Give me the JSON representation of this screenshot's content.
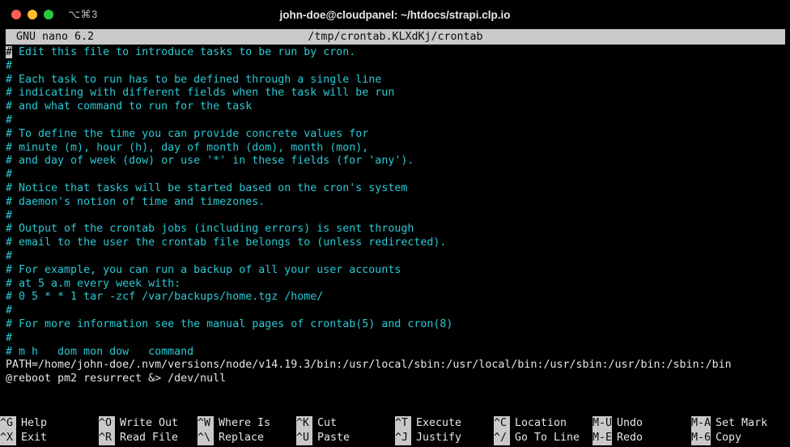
{
  "window": {
    "title": "john-doe@cloudpanel: ~/htdocs/strapi.clp.io",
    "shortcut_badge": "⌥⌘3",
    "traffic_lights": {
      "close": "close-button",
      "minimize": "minimize-button",
      "maximize": "maximize-button"
    },
    "colors": {
      "close": "#ff5f57",
      "minimize": "#febc2e",
      "maximize": "#28c840",
      "background": "#000000",
      "comment_text": "#2ac9d4",
      "plain_text": "#e6e6e6",
      "inverse_bg": "#c9c9c9"
    }
  },
  "nano": {
    "version": "GNU nano 6.2",
    "filename": "/tmp/crontab.KLXdKj/crontab",
    "cursor_char": "#",
    "lines": [
      {
        "cursor": true,
        "head": "#",
        "text": " Edit this file to introduce tasks to be run by cron."
      },
      {
        "cursor": false,
        "head": "",
        "text": "#"
      },
      {
        "cursor": false,
        "head": "",
        "text": "# Each task to run has to be defined through a single line"
      },
      {
        "cursor": false,
        "head": "",
        "text": "# indicating with different fields when the task will be run"
      },
      {
        "cursor": false,
        "head": "",
        "text": "# and what command to run for the task"
      },
      {
        "cursor": false,
        "head": "",
        "text": "#"
      },
      {
        "cursor": false,
        "head": "",
        "text": "# To define the time you can provide concrete values for"
      },
      {
        "cursor": false,
        "head": "",
        "text": "# minute (m), hour (h), day of month (dom), month (mon),"
      },
      {
        "cursor": false,
        "head": "",
        "text": "# and day of week (dow) or use '*' in these fields (for 'any')."
      },
      {
        "cursor": false,
        "head": "",
        "text": "#"
      },
      {
        "cursor": false,
        "head": "",
        "text": "# Notice that tasks will be started based on the cron's system"
      },
      {
        "cursor": false,
        "head": "",
        "text": "# daemon's notion of time and timezones."
      },
      {
        "cursor": false,
        "head": "",
        "text": "#"
      },
      {
        "cursor": false,
        "head": "",
        "text": "# Output of the crontab jobs (including errors) is sent through"
      },
      {
        "cursor": false,
        "head": "",
        "text": "# email to the user the crontab file belongs to (unless redirected)."
      },
      {
        "cursor": false,
        "head": "",
        "text": "#"
      },
      {
        "cursor": false,
        "head": "",
        "text": "# For example, you can run a backup of all your user accounts"
      },
      {
        "cursor": false,
        "head": "",
        "text": "# at 5 a.m every week with:"
      },
      {
        "cursor": false,
        "head": "",
        "text": "# 0 5 * * 1 tar -zcf /var/backups/home.tgz /home/"
      },
      {
        "cursor": false,
        "head": "",
        "text": "#"
      },
      {
        "cursor": false,
        "head": "",
        "text": "# For more information see the manual pages of crontab(5) and cron(8)"
      },
      {
        "cursor": false,
        "head": "",
        "text": "#"
      },
      {
        "cursor": false,
        "head": "",
        "text": "# m h   dom mon dow   command"
      },
      {
        "cursor": false,
        "head": "",
        "plain": true,
        "text": "PATH=/home/john-doe/.nvm/versions/node/v14.19.3/bin:/usr/local/sbin:/usr/local/bin:/usr/sbin:/usr/bin:/sbin:/bin"
      },
      {
        "cursor": false,
        "head": "",
        "plain": true,
        "text": "@reboot pm2 resurrect &> /dev/null"
      }
    ]
  },
  "shortcuts": {
    "row1": [
      {
        "key": "^G",
        "label": "Help"
      },
      {
        "key": "^O",
        "label": "Write Out"
      },
      {
        "key": "^W",
        "label": "Where Is"
      },
      {
        "key": "^K",
        "label": "Cut"
      },
      {
        "key": "^T",
        "label": "Execute"
      },
      {
        "key": "^C",
        "label": "Location"
      },
      {
        "key": "M-U",
        "label": "Undo"
      },
      {
        "key": "M-A",
        "label": "Set Mark"
      }
    ],
    "row2": [
      {
        "key": "^X",
        "label": "Exit"
      },
      {
        "key": "^R",
        "label": "Read File"
      },
      {
        "key": "^\\",
        "label": "Replace"
      },
      {
        "key": "^U",
        "label": "Paste"
      },
      {
        "key": "^J",
        "label": "Justify"
      },
      {
        "key": "^/",
        "label": "Go To Line"
      },
      {
        "key": "M-E",
        "label": "Redo"
      },
      {
        "key": "M-6",
        "label": "Copy"
      }
    ]
  }
}
